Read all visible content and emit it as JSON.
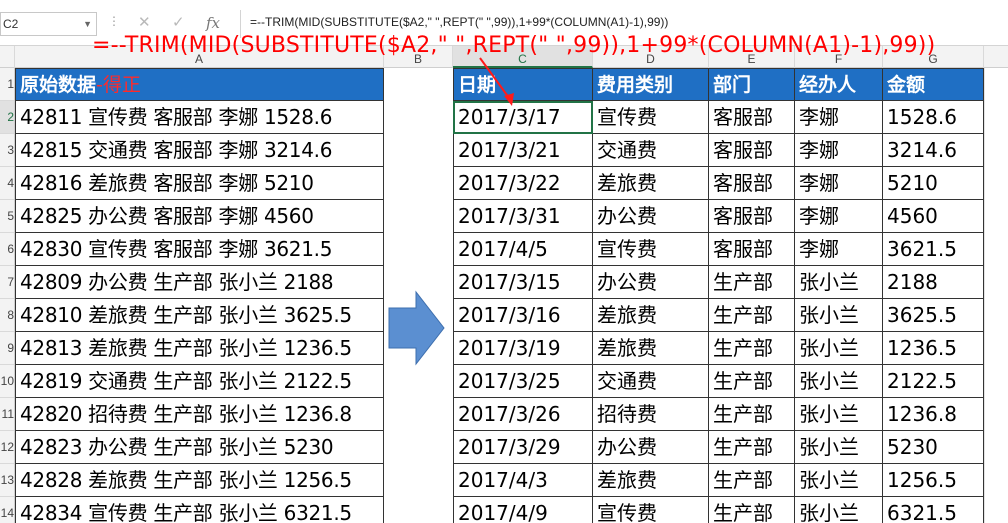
{
  "formula_bar": {
    "name_box": "C2",
    "formula": "=--TRIM(MID(SUBSTITUTE($A2,\" \",REPT(\" \",99)),1+99*(COLUMN(A1)-1),99))",
    "cancel_icon": "close-icon",
    "enter_icon": "check-icon",
    "function_icon": "fx-icon"
  },
  "annotation": {
    "formula": "=--TRIM(MID(SUBSTITUTE($A2,\" \",REPT(\" \",99)),1+99*(COLUMN(A1)-1),99))",
    "color": "#ff0000"
  },
  "columns": [
    "A",
    "B",
    "C",
    "D",
    "E",
    "F",
    "G"
  ],
  "rows": [
    "1",
    "2",
    "3",
    "4",
    "5",
    "6",
    "7",
    "8",
    "9",
    "10",
    "11",
    "12",
    "13",
    "14"
  ],
  "left_table": {
    "header_main": "原始数据",
    "header_suffix": "-得正",
    "rows": [
      "42811 宣传费 客服部 李娜 1528.6",
      "42815 交通费 客服部 李娜 3214.6",
      "42816 差旅费 客服部 李娜 5210",
      "42825 办公费 客服部 李娜 4560",
      "42830 宣传费 客服部 李娜 3621.5",
      "42809 办公费 生产部 张小兰 2188",
      "42810 差旅费 生产部 张小兰 3625.5",
      "42813 差旅费 生产部 张小兰 1236.5",
      "42819 交通费 生产部 张小兰 2122.5",
      "42820 招待费 生产部 张小兰 1236.8",
      "42823 办公费 生产部 张小兰 5230",
      "42828 差旅费 生产部 张小兰 1256.5",
      "42834 宣传费 生产部 张小兰 6321.5"
    ]
  },
  "right_table": {
    "headers": [
      "日期",
      "费用类别",
      "部门",
      "经办人",
      "金额"
    ],
    "rows": [
      [
        "2017/3/17",
        "宣传费",
        "客服部",
        "李娜",
        "1528.6"
      ],
      [
        "2017/3/21",
        "交通费",
        "客服部",
        "李娜",
        "3214.6"
      ],
      [
        "2017/3/22",
        "差旅费",
        "客服部",
        "李娜",
        "5210"
      ],
      [
        "2017/3/31",
        "办公费",
        "客服部",
        "李娜",
        "4560"
      ],
      [
        "2017/4/5",
        "宣传费",
        "客服部",
        "李娜",
        "3621.5"
      ],
      [
        "2017/3/15",
        "办公费",
        "生产部",
        "张小兰",
        "2188"
      ],
      [
        "2017/3/16",
        "差旅费",
        "生产部",
        "张小兰",
        "3625.5"
      ],
      [
        "2017/3/19",
        "差旅费",
        "生产部",
        "张小兰",
        "1236.5"
      ],
      [
        "2017/3/25",
        "交通费",
        "生产部",
        "张小兰",
        "2122.5"
      ],
      [
        "2017/3/26",
        "招待费",
        "生产部",
        "张小兰",
        "1236.8"
      ],
      [
        "2017/3/29",
        "办公费",
        "生产部",
        "张小兰",
        "5230"
      ],
      [
        "2017/4/3",
        "差旅费",
        "生产部",
        "张小兰",
        "1256.5"
      ],
      [
        "2017/4/9",
        "宣传费",
        "生产部",
        "张小兰",
        "6321.5"
      ]
    ]
  },
  "colors": {
    "header_blue": "#1f6fc4",
    "arrow_blue": "#5b8fd1",
    "excel_green": "#217346"
  }
}
